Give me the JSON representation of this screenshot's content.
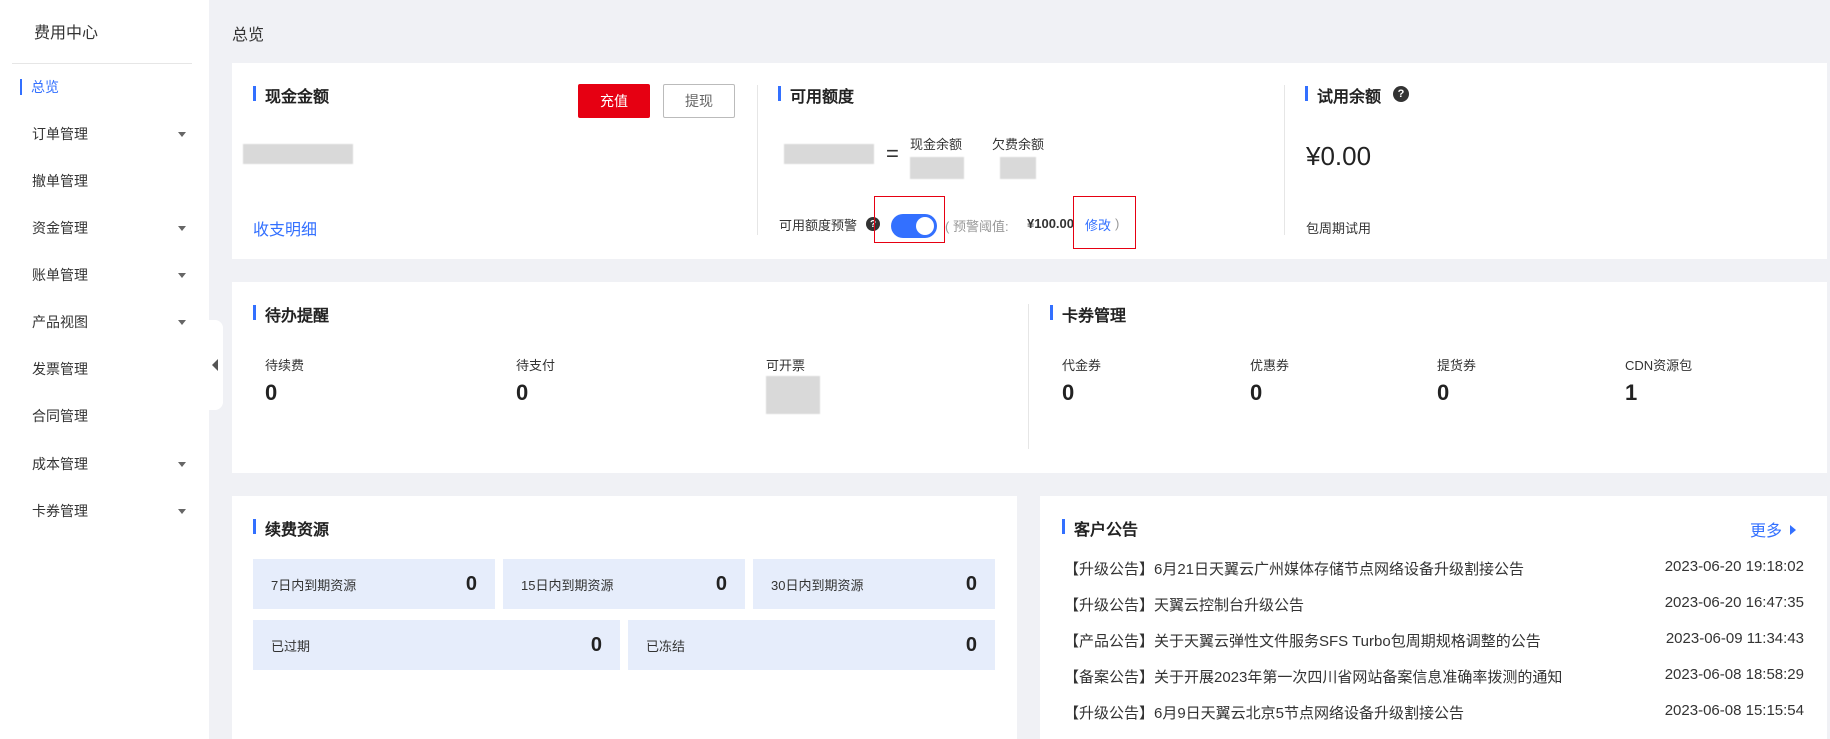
{
  "sidebar": {
    "title": "费用中心",
    "items": [
      {
        "label": "总览",
        "active": true,
        "has_submenu": false
      },
      {
        "label": "订单管理",
        "active": false,
        "has_submenu": true
      },
      {
        "label": "撤单管理",
        "active": false,
        "has_submenu": false
      },
      {
        "label": "资金管理",
        "active": false,
        "has_submenu": true
      },
      {
        "label": "账单管理",
        "active": false,
        "has_submenu": true
      },
      {
        "label": "产品视图",
        "active": false,
        "has_submenu": true
      },
      {
        "label": "发票管理",
        "active": false,
        "has_submenu": false
      },
      {
        "label": "合同管理",
        "active": false,
        "has_submenu": false
      },
      {
        "label": "成本管理",
        "active": false,
        "has_submenu": true
      },
      {
        "label": "卡券管理",
        "active": false,
        "has_submenu": true
      }
    ]
  },
  "page_title": "总览",
  "cash": {
    "title": "现金金额",
    "recharge_label": "充值",
    "withdraw_label": "提现",
    "details_link": "收支明细"
  },
  "available": {
    "title": "可用额度",
    "equals": "=",
    "cash_balance_label": "现金余额",
    "arrears_label": "欠费余额",
    "warning_label": "可用额度预警",
    "warning_enabled": true,
    "threshold_prefix": "( 预警阈值:",
    "threshold_value": "¥100.00",
    "modify_link": "修改",
    "threshold_suffix": ")"
  },
  "trial": {
    "title": "试用余额",
    "amount": "¥0.00",
    "note": "包周期试用"
  },
  "todo": {
    "title": "待办提醒",
    "items": [
      {
        "label": "待续费",
        "value": "0"
      },
      {
        "label": "待支付",
        "value": "0"
      },
      {
        "label": "可开票",
        "value": ""
      }
    ]
  },
  "coupons": {
    "title": "卡券管理",
    "items": [
      {
        "label": "代金券",
        "value": "0"
      },
      {
        "label": "优惠券",
        "value": "0"
      },
      {
        "label": "提货券",
        "value": "0"
      },
      {
        "label": "CDN资源包",
        "value": "1"
      }
    ]
  },
  "renewal": {
    "title": "续费资源",
    "tiles": [
      {
        "label": "7日内到期资源",
        "value": "0"
      },
      {
        "label": "15日内到期资源",
        "value": "0"
      },
      {
        "label": "30日内到期资源",
        "value": "0"
      },
      {
        "label": "已过期",
        "value": "0"
      },
      {
        "label": "已冻结",
        "value": "0"
      }
    ]
  },
  "notices": {
    "title": "客户公告",
    "more_label": "更多",
    "items": [
      {
        "title": "【升级公告】6月21日天翼云广州媒体存储节点网络设备升级割接公告",
        "date": "2023-06-20 19:18:02"
      },
      {
        "title": "【升级公告】天翼云控制台升级公告",
        "date": "2023-06-20 16:47:35"
      },
      {
        "title": "【产品公告】关于天翼云弹性文件服务SFS Turbo包周期规格调整的公告",
        "date": "2023-06-09 11:34:43"
      },
      {
        "title": "【备案公告】关于开展2023年第一次四川省网站备案信息准确率拨测的通知",
        "date": "2023-06-08 18:58:29"
      },
      {
        "title": "【升级公告】6月9日天翼云北京5节点网络设备升级割接公告",
        "date": "2023-06-08 15:15:54"
      }
    ]
  },
  "colors": {
    "accent": "#3370ff",
    "brand_red": "#e60012",
    "tile_bg": "#e6edfb"
  }
}
